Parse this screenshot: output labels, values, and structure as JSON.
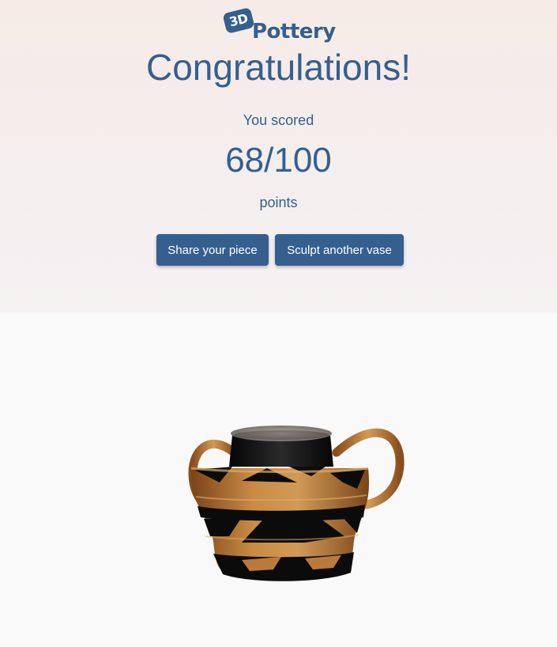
{
  "logo": {
    "badge": "3D",
    "word": "Pottery"
  },
  "title": "Congratulations!",
  "score": {
    "label": "You scored",
    "value": "68/100",
    "unit": "points"
  },
  "buttons": {
    "share": "Share your piece",
    "again": "Sculpt another vase"
  },
  "colors": {
    "brand": "#355f8e",
    "clay_orange": "#c07a35",
    "glaze_black": "#0b0b0b"
  }
}
